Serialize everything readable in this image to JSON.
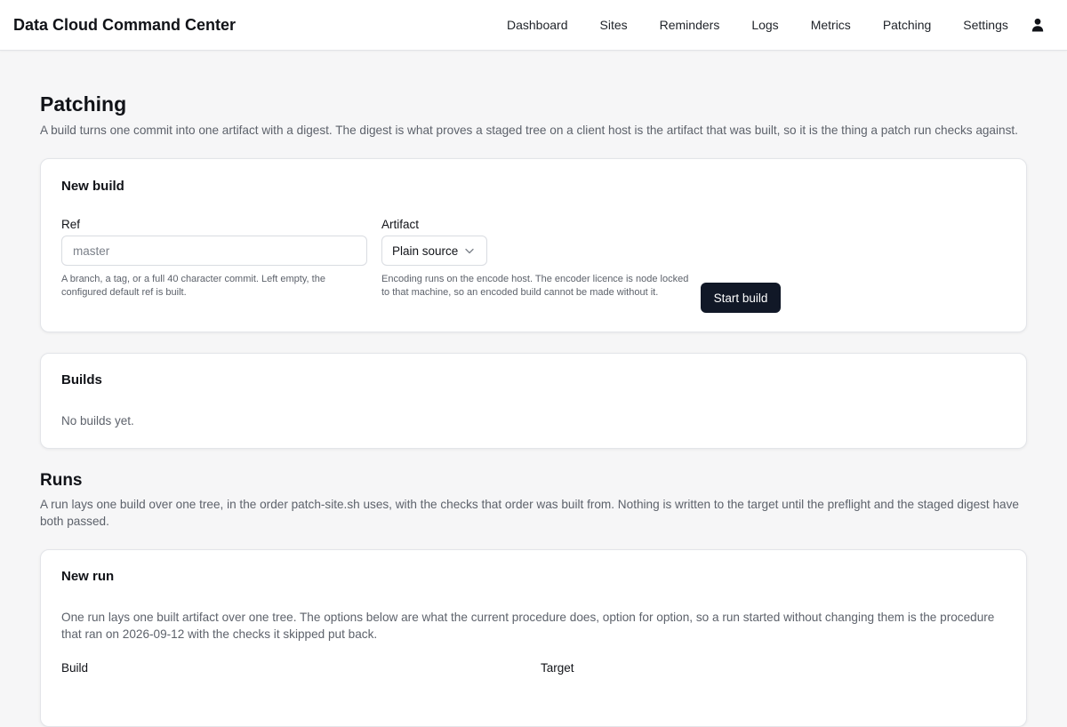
{
  "header": {
    "title": "Data Cloud Command Center",
    "nav": [
      "Dashboard",
      "Sites",
      "Reminders",
      "Logs",
      "Metrics",
      "Patching",
      "Settings"
    ],
    "user_icon": "user-icon"
  },
  "page": {
    "title": "Patching",
    "description": "A build turns one commit into one artifact with a digest. The digest is what proves a staged tree on a client host is the artifact that was built, so it is the thing a patch run checks against."
  },
  "new_build": {
    "title": "New build",
    "ref_label": "Ref",
    "ref_placeholder": "master",
    "ref_help": "A branch, a tag, or a full 40 character commit. Left empty, the configured default ref is built.",
    "artifact_label": "Artifact",
    "artifact_value": "Plain source",
    "artifact_help": "Encoding runs on the encode host. The encoder licence is node locked to that machine, so an encoded build cannot be made without it.",
    "start_label": "Start build"
  },
  "builds": {
    "title": "Builds",
    "empty": "No builds yet."
  },
  "runs": {
    "title": "Runs",
    "description": "A run lays one build over one tree, in the order patch-site.sh uses, with the checks that order was built from. Nothing is written to the target until the preflight and the staged digest have both passed."
  },
  "new_run": {
    "title": "New run",
    "description": "One run lays one built artifact over one tree. The options below are what the current procedure does, option for option, so a run started without changing them is the procedure that ran on 2026-09-12 with the checks it skipped put back.",
    "build_label": "Build",
    "target_label": "Target"
  }
}
